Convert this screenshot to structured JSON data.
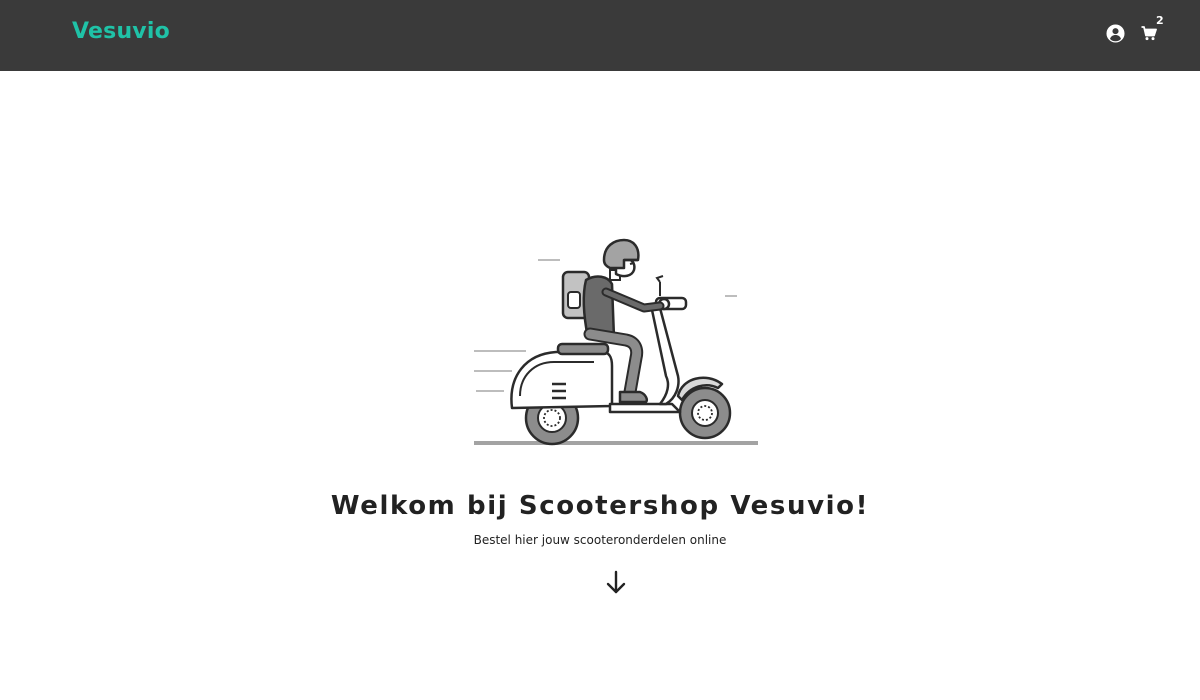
{
  "navbar": {
    "brand": "Vesuvio",
    "account_icon": "user-circle-icon",
    "cart_icon": "shopping-cart-icon",
    "cart_count": "2",
    "background": "#3a3a3a",
    "brand_color": "#1fc2a7"
  },
  "hero": {
    "illustration": "scooter-rider-illustration",
    "title": "Welkom bij Scootershop Vesuvio!",
    "subtitle": "Bestel hier jouw scooteronderdelen online",
    "scroll_icon": "arrow-down-icon"
  }
}
